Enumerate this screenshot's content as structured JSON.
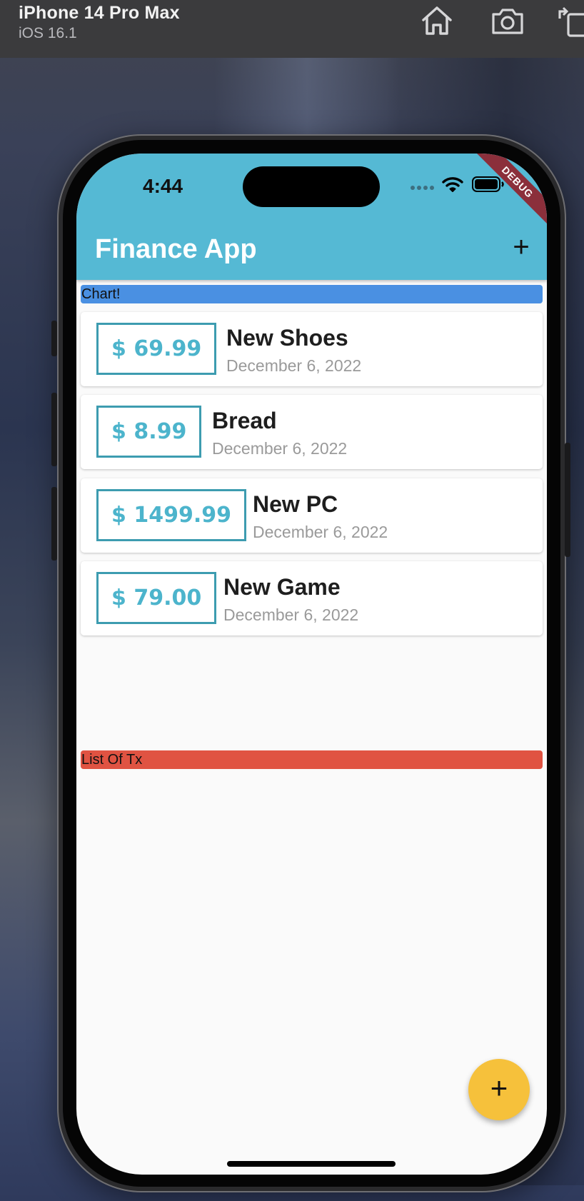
{
  "simulator": {
    "device_name": "iPhone 14 Pro Max",
    "os_version": "iOS 16.1",
    "toolbar_icons": [
      "home-icon",
      "camera-icon",
      "rotate-icon"
    ]
  },
  "status_bar": {
    "time": "4:44",
    "debug_label": "DEBUG"
  },
  "appbar": {
    "title": "Finance App",
    "add_label": "+",
    "color": "#55b9d4"
  },
  "chart": {
    "label": "Chart!",
    "color": "#4a90e2"
  },
  "transactions": [
    {
      "amount": "$ 69.99",
      "title": "New Shoes",
      "date": "December 6, 2022"
    },
    {
      "amount": "$ 8.99",
      "title": "Bread",
      "date": "December 6, 2022"
    },
    {
      "amount": "$ 1499.99",
      "title": "New PC",
      "date": "December 6, 2022"
    },
    {
      "amount": "$ 79.00",
      "title": "New Game",
      "date": "December 6, 2022"
    }
  ],
  "tx_list": {
    "label": "List Of Tx",
    "color": "#e05342"
  },
  "fab": {
    "label": "+",
    "color": "#f6c13b"
  }
}
